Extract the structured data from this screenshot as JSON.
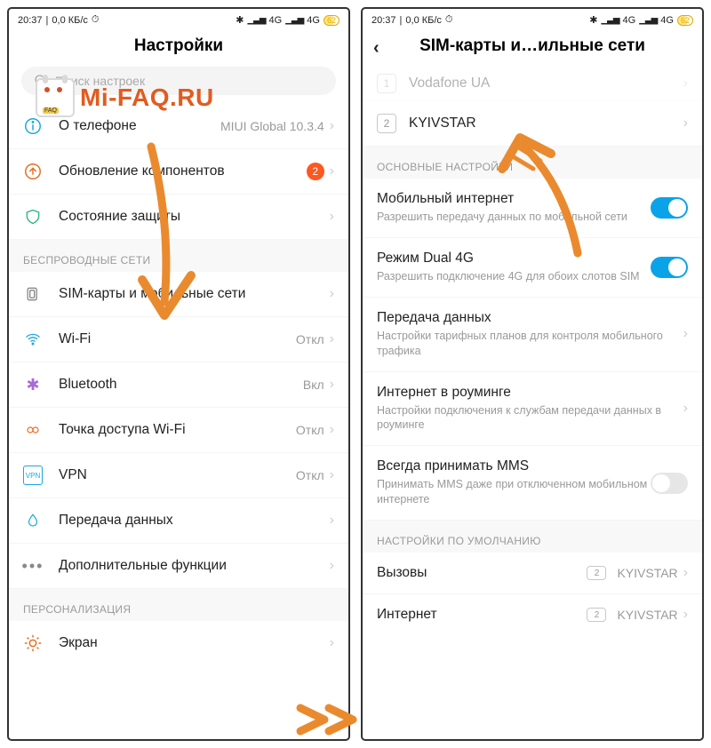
{
  "status": {
    "time": "20:37",
    "net_speed": "0,0 КБ/с",
    "alarm_icon": "⏰",
    "bt_icon": "✱",
    "sig1": "4G",
    "sig2": "4G",
    "battery": "62"
  },
  "left": {
    "title": "Настройки",
    "search_placeholder": "Поиск настроек",
    "rows": {
      "about": {
        "label": "О телефоне",
        "value": "MIUI Global 10.3.4"
      },
      "update": {
        "label": "Обновление компонентов",
        "badge": "2"
      },
      "security": {
        "label": "Состояние защиты"
      }
    },
    "section_wireless": "БЕСПРОВОДНЫЕ СЕТИ",
    "wireless": {
      "sim": {
        "label": "SIM-карты и мобильные сети"
      },
      "wifi": {
        "label": "Wi-Fi",
        "value": "Откл"
      },
      "bt": {
        "label": "Bluetooth",
        "value": "Вкл"
      },
      "hotspot": {
        "label": "Точка доступа Wi-Fi",
        "value": "Откл"
      },
      "vpn": {
        "label": "VPN",
        "value": "Откл"
      },
      "data": {
        "label": "Передача данных"
      },
      "more": {
        "label": "Дополнительные функции"
      }
    },
    "section_pers": "ПЕРСОНАЛИЗАЦИЯ",
    "pers": {
      "display": {
        "label": "Экран"
      }
    }
  },
  "right": {
    "title": "SIM-карты и…ильные сети",
    "sim_rows": {
      "sim1": {
        "num": "1",
        "label": "Vodafone UA"
      },
      "sim2": {
        "num": "2",
        "label": "KYIVSTAR"
      }
    },
    "section_main": "ОСНОВНЫЕ НАСТРОЙКИ",
    "main": {
      "mobile_net": {
        "title": "Мобильный интернет",
        "sub": "Разрешить передачу данных по мобильной сети",
        "on": true
      },
      "dual4g": {
        "title": "Режим Dual 4G",
        "sub": "Разрешить подключение 4G для обоих слотов SIM",
        "on": true
      },
      "usage": {
        "title": "Передача данных",
        "sub": "Настройки тарифных планов для контроля мобильного трафика"
      },
      "roaming": {
        "title": "Интернет в роуминге",
        "sub": "Настройки подключения к службам передачи данных в роуминге"
      },
      "mms": {
        "title": "Всегда принимать MMS",
        "sub": "Принимать MMS даже при отключенном мобильном интернете",
        "on": false
      }
    },
    "section_default": "НАСТРОЙКИ ПО УМОЛЧАНИЮ",
    "defaults": {
      "calls": {
        "title": "Вызовы",
        "sim": "2",
        "carrier": "KYIVSTAR"
      },
      "internet": {
        "title": "Интернет",
        "sim": "2",
        "carrier": "KYIVSTAR"
      }
    }
  },
  "watermark": "Mi-FAQ.RU",
  "colors": {
    "accent": "#0aa3e8",
    "badge": "#ff5722",
    "watermark": "#e25b1f",
    "arrow": "#ea8a2e"
  }
}
